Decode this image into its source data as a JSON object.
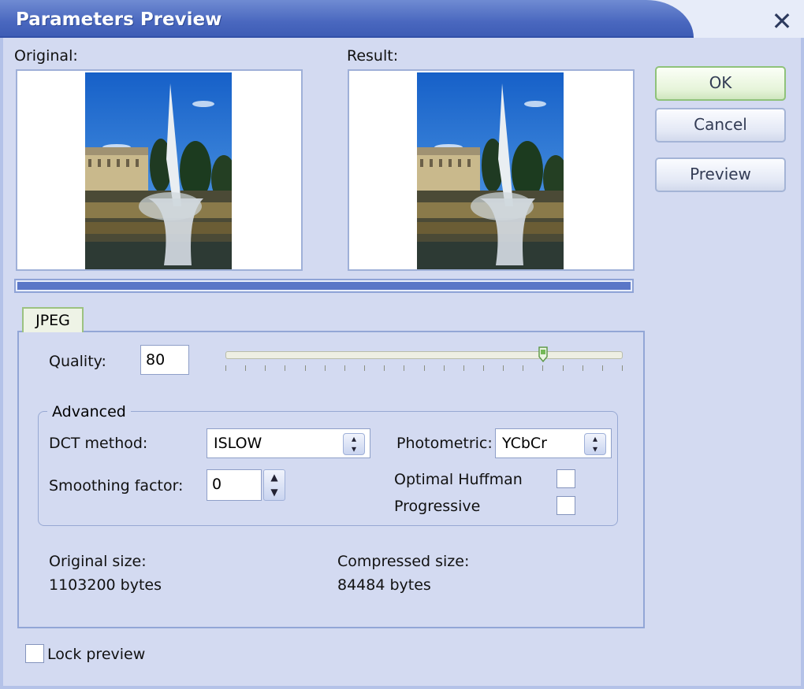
{
  "window": {
    "title": "Parameters Preview",
    "close_glyph": "✕"
  },
  "previews": {
    "original_label": "Original:",
    "result_label": "Result:"
  },
  "progress": {
    "value": 1.0
  },
  "buttons": {
    "ok": "OK",
    "cancel": "Cancel",
    "preview": "Preview"
  },
  "tabs": [
    {
      "label": "JPEG",
      "selected": true
    }
  ],
  "jpeg": {
    "quality_label": "Quality:",
    "quality_value": "80",
    "quality_slider": {
      "value": 80,
      "min": 0,
      "max": 100
    },
    "advanced": {
      "title": "Advanced",
      "dct_label": "DCT method:",
      "dct_value": "ISLOW",
      "smoothing_label": "Smoothing factor:",
      "smoothing_value": "0",
      "photometric_label": "Photometric:",
      "photometric_value": "YCbCr",
      "optimal_huffman_label": "Optimal Huffman",
      "optimal_huffman_checked": false,
      "progressive_label": "Progressive",
      "progressive_checked": false
    },
    "original_size_label": "Original size:",
    "original_size_value": "1103200 bytes",
    "compressed_size_label": "Compressed size:",
    "compressed_size_value": "84484 bytes"
  },
  "lock_preview": {
    "label": "Lock preview",
    "checked": false
  },
  "icons": {
    "close": "close-icon",
    "select_arrow": "up-down-arrows-icon",
    "spinner": "spinner-arrows-icon"
  },
  "colors": {
    "title_bar": "#4a68bf",
    "dialog_bg": "#d3daf1",
    "ok_button_border": "#8fc27a",
    "progress_fill": "#5a76c7"
  }
}
